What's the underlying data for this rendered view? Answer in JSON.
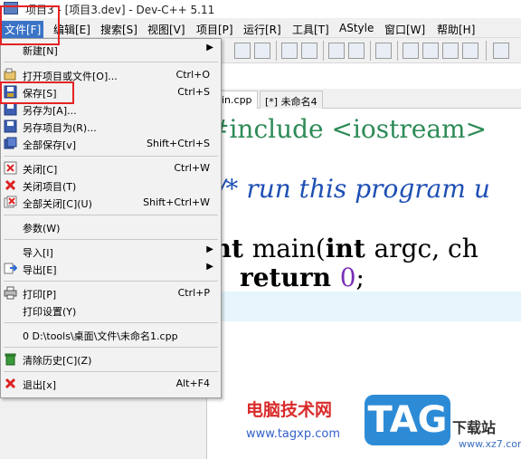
{
  "window": {
    "title": "项目3 - [项目3.dev] - Dev-C++ 5.11"
  },
  "menubar": [
    {
      "label": "文件[F]",
      "active": true
    },
    {
      "label": "编辑[E]"
    },
    {
      "label": "搜索[S]"
    },
    {
      "label": "视图[V]"
    },
    {
      "label": "项目[P]"
    },
    {
      "label": "运行[R]"
    },
    {
      "label": "工具[T]"
    },
    {
      "label": "AStyle"
    },
    {
      "label": "窗口[W]"
    },
    {
      "label": "帮助[H]"
    }
  ],
  "file_menu": {
    "items": [
      {
        "label": "新建[N]",
        "shortcut": "",
        "submenu": true,
        "icon": ""
      },
      {
        "label": "打开项目或文件[O]...",
        "shortcut": "Ctrl+O",
        "icon": "open-folder-icon"
      },
      {
        "label": "保存[S]",
        "shortcut": "Ctrl+S",
        "icon": "save-icon"
      },
      {
        "label": "另存为[A]...",
        "shortcut": "",
        "icon": "save-as-icon"
      },
      {
        "label": "另存项目为(R)...",
        "shortcut": "",
        "icon": "save-project-icon"
      },
      {
        "label": "全部保存[v]",
        "shortcut": "Shift+Ctrl+S",
        "icon": "save-all-icon"
      },
      {
        "label": "关闭[C]",
        "shortcut": "Ctrl+W",
        "icon": "close-file-icon"
      },
      {
        "label": "关闭项目(T)",
        "shortcut": "",
        "icon": "close-project-icon"
      },
      {
        "label": "全部关闭[C](U)",
        "shortcut": "Shift+Ctrl+W",
        "icon": "close-all-icon"
      },
      {
        "label": "参数(W)",
        "shortcut": "",
        "icon": ""
      },
      {
        "label": "导入[I]",
        "shortcut": "",
        "submenu": true,
        "icon": ""
      },
      {
        "label": "导出[E]",
        "shortcut": "",
        "submenu": true,
        "icon": "export-icon"
      },
      {
        "label": "打印[P]",
        "shortcut": "Ctrl+P",
        "icon": "print-icon"
      },
      {
        "label": "打印设置(Y)",
        "shortcut": "",
        "icon": ""
      },
      {
        "label": "0 D:\\tools\\桌面\\文件\\未命名1.cpp",
        "shortcut": "",
        "icon": ""
      },
      {
        "label": "清除历史[C](Z)",
        "shortcut": "",
        "icon": "clear-history-icon"
      },
      {
        "label": "退出[x]",
        "shortcut": "Alt+F4",
        "icon": "exit-icon"
      }
    ]
  },
  "editor": {
    "tabs": [
      "in.cpp",
      "[*] 未命名4"
    ],
    "code": {
      "line1": "#include <iostream>",
      "line2": "/* run this program u",
      "line3a": "int ",
      "line3b": "main(",
      "line3c": "int ",
      "line3d": "argc, ch",
      "line4a": "    return ",
      "line4b": "0",
      "line4c": ";"
    }
  },
  "watermark": {
    "cn": "电脑技术网",
    "url": "www.tagxp.com",
    "tag": "TAG",
    "side1": "下载站",
    "side2": "www.xz7.com"
  },
  "colors": {
    "highlight_box": "#e52424",
    "menu_active": "#3b74c7"
  }
}
